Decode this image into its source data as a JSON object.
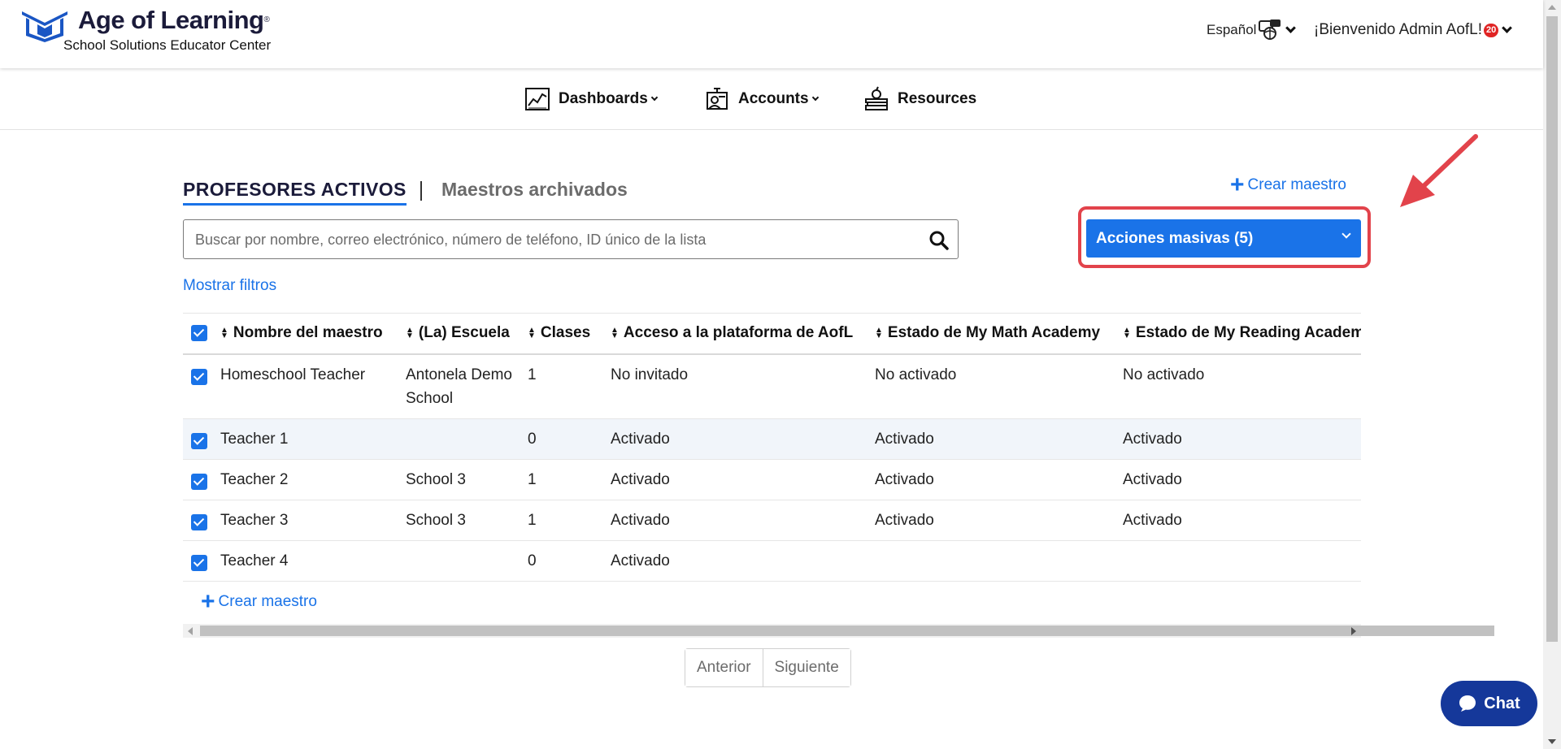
{
  "header": {
    "brand_title": "Age of Learning",
    "brand_trademark": "®",
    "brand_subtitle": "School Solutions Educator Center",
    "language_label": "Español",
    "welcome_text": "¡Bienvenido Admin AofL!",
    "notification_count": "20"
  },
  "nav": {
    "items": [
      {
        "label": "Dashboards",
        "icon": "chart-icon",
        "has_dropdown": true
      },
      {
        "label": "Accounts",
        "icon": "teacher-board-icon",
        "has_dropdown": true
      },
      {
        "label": "Resources",
        "icon": "books-apple-icon",
        "has_dropdown": false
      }
    ]
  },
  "tabs": {
    "active": "PROFESORES ACTIVOS",
    "inactive": "Maestros archivados"
  },
  "actions": {
    "create_teacher": "Crear maestro",
    "bulk_actions": "Acciones masivas (5)",
    "show_filters": "Mostrar filtros"
  },
  "search": {
    "placeholder": "Buscar por nombre, correo electrónico, número de teléfono, ID único de la lista",
    "value": ""
  },
  "table": {
    "columns": [
      "Nombre del maestro",
      "(La) Escuela",
      "Clases",
      "Acceso a la plataforma de AofL",
      "Estado de My Math Academy",
      "Estado de My Reading Academy"
    ],
    "rows": [
      {
        "selected": true,
        "highlighted": false,
        "name": "Homeschool Teacher",
        "school": "Antonela Demo School",
        "classes": "1",
        "platform_access": "No invitado",
        "math_status": "No activado",
        "reading_status": "No activado"
      },
      {
        "selected": true,
        "highlighted": true,
        "name": "Teacher 1",
        "school": "",
        "classes": "0",
        "platform_access": "Activado",
        "math_status": "Activado",
        "reading_status": "Activado"
      },
      {
        "selected": true,
        "highlighted": false,
        "name": "Teacher 2",
        "school": "School 3",
        "classes": "1",
        "platform_access": "Activado",
        "math_status": "Activado",
        "reading_status": "Activado"
      },
      {
        "selected": true,
        "highlighted": false,
        "name": "Teacher 3",
        "school": "School 3",
        "classes": "1",
        "platform_access": "Activado",
        "math_status": "Activado",
        "reading_status": "Activado"
      },
      {
        "selected": true,
        "highlighted": false,
        "name": "Teacher 4",
        "school": "",
        "classes": "0",
        "platform_access": "Activado",
        "math_status": "",
        "reading_status": ""
      }
    ]
  },
  "pager": {
    "previous": "Anterior",
    "next": "Siguiente"
  },
  "chat": {
    "label": "Chat"
  },
  "colors": {
    "accent": "#1a73e8",
    "highlight_outline": "#e2434b",
    "chat_bg": "#15389a",
    "notification_badge": "#e02424"
  }
}
